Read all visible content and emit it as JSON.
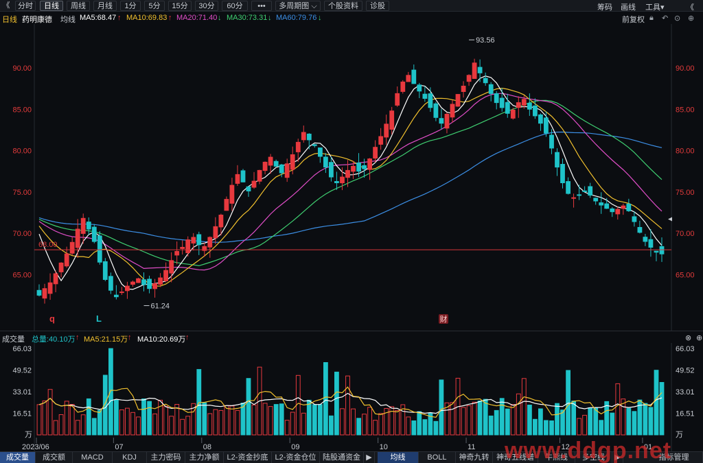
{
  "toolbar": {
    "back": "《",
    "periods": [
      "分时",
      "日线",
      "周线",
      "月线",
      "1分",
      "5分",
      "15分",
      "30分",
      "60分",
      "•••",
      "多周期图 ⌵",
      "个股资料",
      "诊股"
    ],
    "right": [
      "筹码",
      "画线",
      "工具▾",
      "《"
    ]
  },
  "header": {
    "period": "日线",
    "name": "药明康德",
    "ma_label": "均线",
    "ma5": "MA5:68.47",
    "ma10": "MA10:69.83",
    "ma20": "MA20:71.40",
    "ma30": "MA30:73.31",
    "ma60": "MA60:79.76",
    "adjust": "前复权",
    "icons": [
      "lock-icon",
      "undo-icon",
      "more-icon",
      "add-icon"
    ]
  },
  "colors": {
    "up": "#e8393e",
    "down": "#1fc3c9",
    "ma5": "#ffffff",
    "ma10": "#f2c12e",
    "ma20": "#e14ec8",
    "ma30": "#3fcf71",
    "ma60": "#3c8fe6",
    "axis_text": "#e23b3b",
    "ref_line": "#d6353b"
  },
  "price_axis": {
    "left_labels": [
      "90.00",
      "85.00",
      "80.00",
      "75.00",
      "70.00",
      "65.00"
    ],
    "right_labels": [
      "90.00",
      "85.00",
      "80.00",
      "75.00",
      "70.00",
      "65.00"
    ],
    "ref_label": "68.00"
  },
  "annotations": {
    "high": "93.56",
    "low": "61.24",
    "marker_q": "q",
    "marker_l": "L",
    "marker_cai": "财"
  },
  "volume": {
    "title": "成交量",
    "total": "总量:40.10万",
    "ma5": "MA5:21.15万",
    "ma10": "MA10:20.69万",
    "left_labels": [
      "66.03",
      "49.52",
      "33.01",
      "16.51",
      "万"
    ],
    "right_labels": [
      "66.03",
      "49.52",
      "33.01",
      "16.51",
      "万"
    ]
  },
  "date_axis": [
    "2023/06",
    "07",
    "08",
    "09",
    "10",
    "11",
    "12",
    "01"
  ],
  "tabs": [
    "成交量",
    "成交额",
    "MACD",
    "KDJ",
    "主力密码",
    "主力净额",
    "L2-资金抄底",
    "L2-资金仓位",
    "陆股通资金",
    "均线",
    "BOLL",
    "神奇九转",
    "神奇五线谱",
    "牛熊线",
    "多空线",
    "指标管理"
  ],
  "watermark": "www.ddgp.net",
  "chart_data": {
    "type": "candlestick",
    "stock": "药明康德",
    "period": "日线",
    "ylim": [
      61,
      95
    ],
    "high": 93.56,
    "low": 61.24,
    "reference_price": 68.0,
    "months": [
      "2023/06",
      "07",
      "08",
      "09",
      "10",
      "11",
      "12",
      "01"
    ],
    "ma_last": {
      "MA5": 68.47,
      "MA10": 69.83,
      "MA20": 71.4,
      "MA30": 73.31,
      "MA60": 79.76
    },
    "closes": [
      62.5,
      63.3,
      64.0,
      65.1,
      66.4,
      67.5,
      68.9,
      70.5,
      71.8,
      70.5,
      69.0,
      66.5,
      64.4,
      63.1,
      62.3,
      62.9,
      63.6,
      64.1,
      64.5,
      63.8,
      63.3,
      63.9,
      64.6,
      65.5,
      66.7,
      67.8,
      68.3,
      69.2,
      69.5,
      68.6,
      68.4,
      69.5,
      70.8,
      72.2,
      74.1,
      75.8,
      77.1,
      76.2,
      75.1,
      76.3,
      77.6,
      78.6,
      79.2,
      78.1,
      77.3,
      78.4,
      79.5,
      81.0,
      82.2,
      81.3,
      80.6,
      79.3,
      78.0,
      76.8,
      76.1,
      76.8,
      77.6,
      78.1,
      77.5,
      77.8,
      79.0,
      80.4,
      81.7,
      83.2,
      84.8,
      86.9,
      88.3,
      89.1,
      88.1,
      87.2,
      86.3,
      85.2,
      84.0,
      83.3,
      84.4,
      85.6,
      86.8,
      87.8,
      89.1,
      90.6,
      89.4,
      88.2,
      86.9,
      85.8,
      85.2,
      84.5,
      84.9,
      85.8,
      86.2,
      85.0,
      84.2,
      83.3,
      82.1,
      80.3,
      78.0,
      76.1,
      74.8,
      74.3,
      74.6,
      75.1,
      74.6,
      73.9,
      73.4,
      73.0,
      72.6,
      72.9,
      73.3,
      72.7,
      71.4,
      70.1,
      69.0,
      68.3,
      67.7,
      67.5
    ],
    "volume_unit": "万",
    "volume_ylim": [
      0,
      66.03
    ],
    "volume_last": 40.1,
    "volume_ma5": 21.15,
    "volume_ma10": 20.69
  }
}
